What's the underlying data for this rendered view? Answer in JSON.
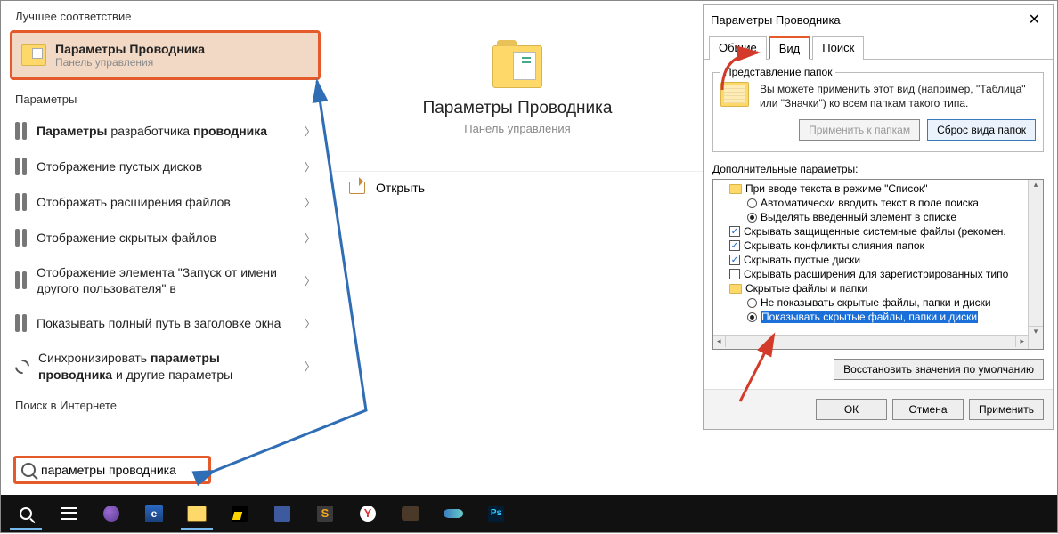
{
  "search": {
    "best_header": "Лучшее соответствие",
    "best_title": "Параметры Проводника",
    "best_sub": "Панель управления",
    "params_header": "Параметры",
    "items": [
      {
        "pre": "",
        "b": "Параметры",
        "post": " разработчика ",
        "b2": "проводника",
        "post2": ""
      },
      {
        "pre": "Отображение пустых дисков"
      },
      {
        "pre": "Отображать расширения файлов"
      },
      {
        "pre": "Отображение скрытых файлов"
      },
      {
        "pre": "Отображение элемента \"Запуск от имени другого пользователя\" в"
      },
      {
        "pre": "Показывать полный путь в заголовке окна"
      },
      {
        "pre": "Синхронизировать ",
        "b": "параметры проводника",
        "post": " и другие параметры"
      }
    ],
    "internet_header": "Поиск в Интернете",
    "query": "параметры проводника"
  },
  "detail": {
    "title": "Параметры Проводника",
    "sub": "Панель управления",
    "open": "Открыть"
  },
  "dialog": {
    "title": "Параметры Проводника",
    "tabs": {
      "general": "Общие",
      "view": "Вид",
      "search": "Поиск"
    },
    "folder_views_legend": "Представление папок",
    "folder_views_text": "Вы можете применить этот вид (например, \"Таблица\" или \"Значки\") ко всем папкам такого типа.",
    "apply_btn": "Применить к папкам",
    "reset_btn": "Сброс вида папок",
    "adv_label": "Дополнительные параметры:",
    "tree": {
      "n0": "При вводе текста в режиме \"Список\"",
      "n0a": "Автоматически вводить текст в поле поиска",
      "n0b": "Выделять введенный элемент в списке",
      "n1": "Скрывать защищенные системные файлы (рекомен.",
      "n2": "Скрывать конфликты слияния папок",
      "n3": "Скрывать пустые диски",
      "n4": "Скрывать расширения для зарегистрированных типо",
      "n5": "Скрытые файлы и папки",
      "n5a": "Не показывать скрытые файлы, папки и диски",
      "n5b": "Показывать скрытые файлы, папки и диски"
    },
    "restore": "Восстановить значения по умолчанию",
    "ok": "ОК",
    "cancel": "Отмена",
    "apply": "Применить"
  }
}
